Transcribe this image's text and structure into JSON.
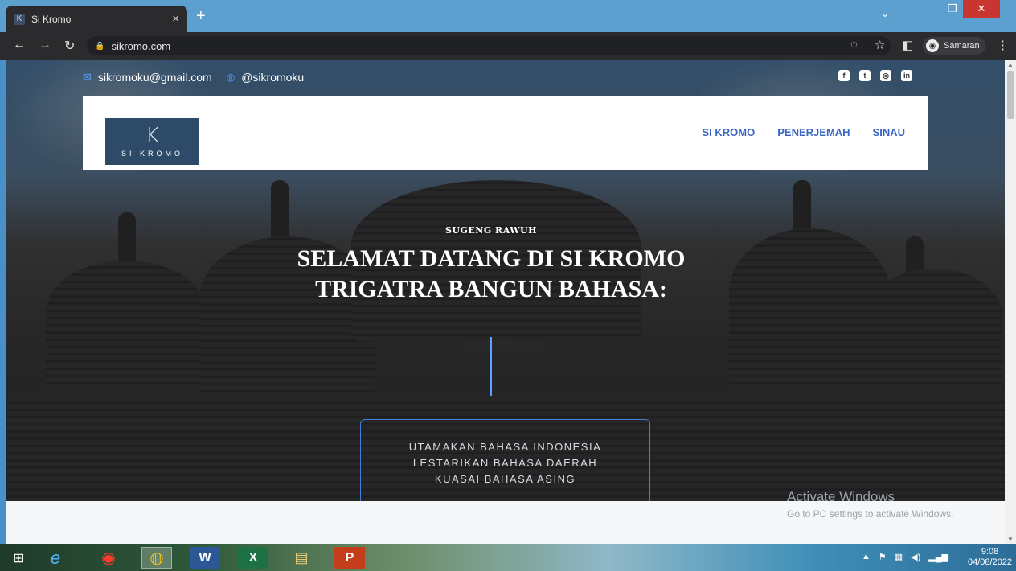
{
  "browser": {
    "tab_title": "Si Kromo",
    "tab_favicon": "K",
    "new_tab": "+",
    "url": "sikromo.com",
    "profile_label": "Samaran"
  },
  "topbar": {
    "email": "sikromoku@gmail.com",
    "instagram": "@sikromoku",
    "social_icons": [
      "facebook-icon",
      "twitter-icon",
      "instagram-icon",
      "linkedin-icon"
    ]
  },
  "header": {
    "logo_mark": "K",
    "logo_text": "SI KROMO",
    "menu": [
      "SI KROMO",
      "PENERJEMAH",
      "SINAU"
    ]
  },
  "hero": {
    "subtitle": "SUGENG RAWUH",
    "title_line1": "SELAMAT DATANG DI SI KROMO",
    "title_line2": "TRIGATRA BANGUN BAHASA:",
    "motto": [
      "UTAMAKAN BAHASA INDONESIA",
      "LESTARIKAN BAHASA DAERAH",
      "KUASAI BAHASA ASING"
    ]
  },
  "watermark": {
    "line1": "Activate Windows",
    "line2": "Go to PC settings to activate Windows."
  },
  "taskbar": {
    "apps": [
      "windows-start-icon",
      "internet-explorer-icon",
      "opera-icon",
      "chrome-icon",
      "word-icon",
      "excel-icon",
      "file-explorer-icon",
      "powerpoint-icon"
    ],
    "time": "9:08",
    "date": "04/08/2022"
  },
  "colors": {
    "accent_blue": "#3b66c3",
    "icon_blue": "#5aa5ff",
    "logo_bg": "#2d4a68"
  }
}
